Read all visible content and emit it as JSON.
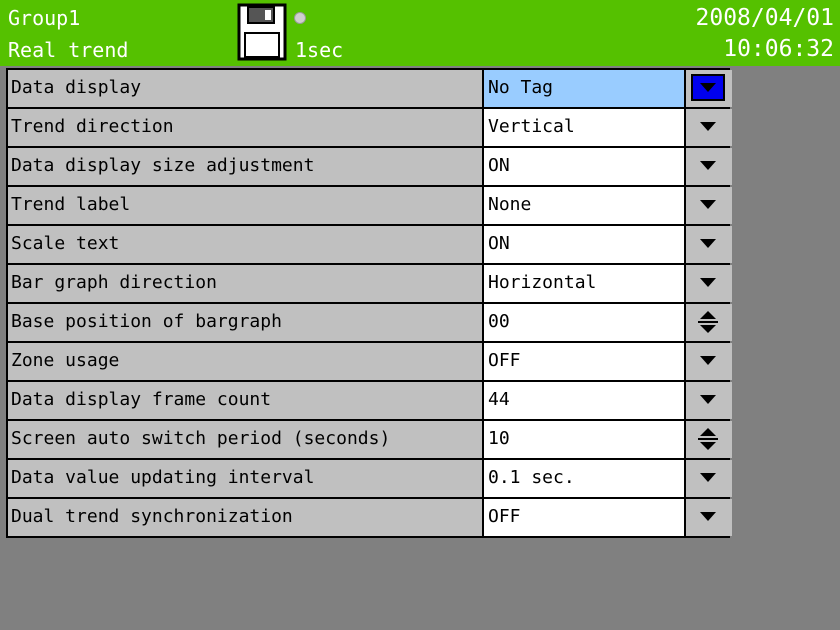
{
  "header": {
    "group": "Group1",
    "screen": "Real trend",
    "interval": "1sec",
    "date": "2008/04/01",
    "time": "10:06:32",
    "icons": [
      "floppy-disk-icon",
      "status-led-icon"
    ]
  },
  "colors": {
    "header_bg": "#55c100",
    "selected_value_bg": "#99ccff",
    "selected_control_bg": "#0000ee"
  },
  "settings": [
    {
      "label": "Data display",
      "value": "No Tag",
      "control": "dropdown",
      "selected": true
    },
    {
      "label": "Trend direction",
      "value": "Vertical",
      "control": "dropdown"
    },
    {
      "label": "Data display size adjustment",
      "value": "ON",
      "control": "dropdown"
    },
    {
      "label": "Trend label",
      "value": "None",
      "control": "dropdown"
    },
    {
      "label": "Scale text",
      "value": "ON",
      "control": "dropdown"
    },
    {
      "label": "Bar graph direction",
      "value": "Horizontal",
      "control": "dropdown"
    },
    {
      "label": "Base position of bargraph",
      "value": "00",
      "control": "spinner"
    },
    {
      "label": "Zone usage",
      "value": "OFF",
      "control": "dropdown"
    },
    {
      "label": "Data display frame count",
      "value": "44",
      "control": "dropdown"
    },
    {
      "label": "Screen auto switch period (seconds)",
      "value": "10",
      "control": "spinner"
    },
    {
      "label": "Data value updating interval",
      "value": "0.1 sec.",
      "control": "dropdown"
    },
    {
      "label": "Dual trend synchronization",
      "value": "OFF",
      "control": "dropdown"
    }
  ]
}
